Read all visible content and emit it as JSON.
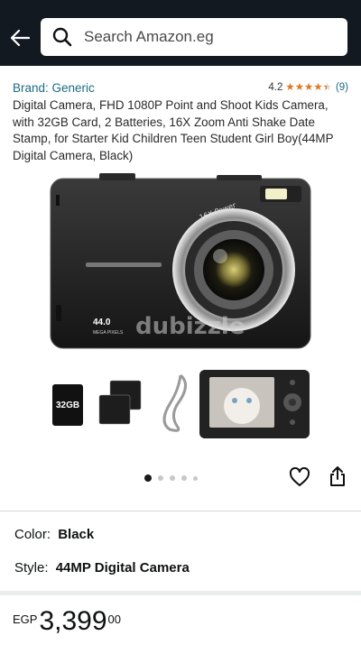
{
  "search": {
    "placeholder": "Search Amazon.eg"
  },
  "product": {
    "brand": "Brand: Generic",
    "rating": "4.2",
    "rating_count": "(9)",
    "stars": 4.2,
    "title": "Digital Camera, FHD 1080P Point and Shoot Kids Camera, with 32GB Card, 2 Batteries, 16X Zoom Anti Shake Date Stamp, for Starter Kid Children Teen Student Girl Boy(44MP Digital Camera, Black)"
  },
  "gallery": {
    "camera_badge_value": "44.0",
    "camera_badge_sub": "MEGA PIXELS",
    "sd_card_label": "32GB",
    "lens_text": "16X Power",
    "watermark": "dubizzle",
    "dot_count": 5,
    "active_dot": 0
  },
  "options": {
    "color_label": "Color:",
    "color_value": "Black",
    "style_label": "Style:",
    "style_value": "44MP Digital Camera"
  },
  "price": {
    "currency": "EGP",
    "whole": "3,399",
    "fraction": "00"
  },
  "colors": {
    "topbar": "#131921",
    "link": "#1b6b82",
    "star": "#de7921"
  }
}
